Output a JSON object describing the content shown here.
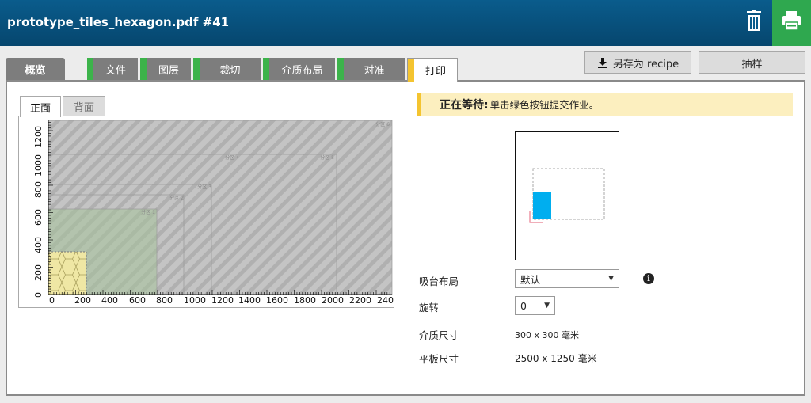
{
  "header": {
    "title": "prototype_tiles_hexagon.pdf #41"
  },
  "toolbar": {
    "save_label": "另存为 recipe",
    "sample_label": "抽样"
  },
  "tabs": [
    {
      "label": "概览",
      "bar_color": ""
    },
    {
      "label": "文件",
      "bar_color": "#3cb34a"
    },
    {
      "label": "图层",
      "bar_color": "#3cb34a"
    },
    {
      "label": "裁切",
      "bar_color": "#3cb34a"
    },
    {
      "label": "介质布局",
      "bar_color": "#3cb34a"
    },
    {
      "label": "对准",
      "bar_color": "#3cb34a"
    },
    {
      "label": "打印",
      "bar_color": "#f4c430"
    }
  ],
  "side_tabs": {
    "front": "正面",
    "back": "背面"
  },
  "preview": {
    "x_ticks": [
      "0",
      "200",
      "400",
      "600",
      "800",
      "1000",
      "1200",
      "1400",
      "1600",
      "1800",
      "2000",
      "2200",
      "240"
    ],
    "y_ticks": [
      "0",
      "200",
      "400",
      "600",
      "800",
      "1000",
      "1200"
    ],
    "zones": [
      "分区 1",
      "分区 2",
      "分区 3",
      "分区 4",
      "分区 5",
      "分区 6"
    ]
  },
  "status": {
    "bold": "正在等待:",
    "text": "单击绿色按钮提交作业。"
  },
  "settings": {
    "vacuum_label": "吸台布局",
    "vacuum_value": "默认",
    "rotation_label": "旋转",
    "rotation_value": "0",
    "media_size_label": "介质尺寸",
    "media_size_value": "300 x 300 毫米",
    "table_size_label": "平板尺寸",
    "table_size_value": "2500 x 1250 毫米"
  },
  "colors": {
    "header": "#0a5c8c",
    "print_button": "#2fa84f",
    "ok_bar": "#3cb34a",
    "active_bar": "#f4c430",
    "media_fill": "#00aeef"
  },
  "icons": {
    "trash": "trash-icon",
    "print": "printer-icon",
    "download": "download-icon",
    "info": "info-icon"
  }
}
